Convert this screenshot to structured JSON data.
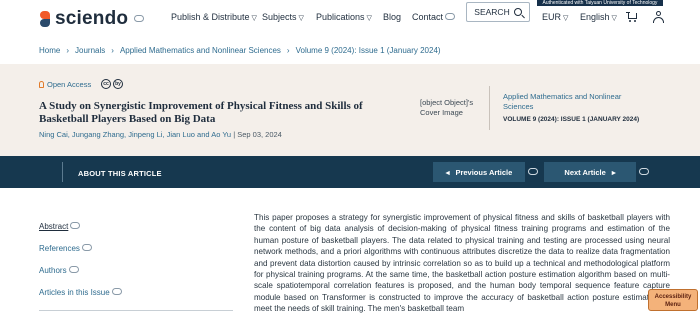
{
  "header": {
    "brand": "sciendo",
    "nav": [
      {
        "label": "Publish & Distribute"
      },
      {
        "label": "Subjects"
      },
      {
        "label": "Publications"
      },
      {
        "label": "Blog"
      },
      {
        "label": "Contact"
      }
    ],
    "auth_notice": "Authenticated with Taiyuan University of Technology",
    "search_label": "SEARCH",
    "currency": "EUR",
    "language": "English"
  },
  "breadcrumb": [
    "Home",
    "Journals",
    "Applied Mathematics and Nonlinear Sciences",
    "Volume 9 (2024): Issue 1 (January 2024)"
  ],
  "article": {
    "open_access": "Open Access",
    "cc_badges": [
      "cc",
      "by"
    ],
    "title": "A Study on Synergistic Improvement of Physical Fitness and Skills of Basketball Players Based on Big Data",
    "authors": "Ning Cai, Jungang Zhang, Jinpeng Li, Jian Luo and Ao Yu",
    "date": "| Sep 03, 2024",
    "cover_alt": "[object Object]'s Cover Image",
    "journal": "Applied Mathematics and Nonlinear Sciences",
    "issue": "VOLUME 9 (2024): ISSUE 1 (JANUARY 2024)"
  },
  "article_bar": {
    "about": "ABOUT THIS ARTICLE",
    "prev": "Previous Article",
    "next": "Next Article"
  },
  "sidebar": {
    "items": [
      {
        "label": "Abstract"
      },
      {
        "label": "References"
      },
      {
        "label": "Authors"
      },
      {
        "label": "Articles in this Issue"
      }
    ]
  },
  "abstract_text": "This paper proposes a strategy for synergistic improvement of physical fitness and skills of basketball players with the content of big data analysis of decision-making of physical fitness training programs and estimation of the human posture of basketball players. The data related to physical training and testing are processed using neural network methods, and a priori algorithms with continuous attributes discretize the data to realize data fragmentation and prevent data distortion caused by intrinsic correlation so as to build up a technical and methodological platform for physical training programs. At the same time, the basketball action posture estimation algorithm based on multi-scale spatiotemporal correlation features is proposed, and the human body temporal sequence feature capture module based on Transformer is constructed to improve the accuracy of basketball action posture estimation to meet the needs of skill training. The men's basketball team",
  "accessibility_label": "Accessibility Menu"
}
